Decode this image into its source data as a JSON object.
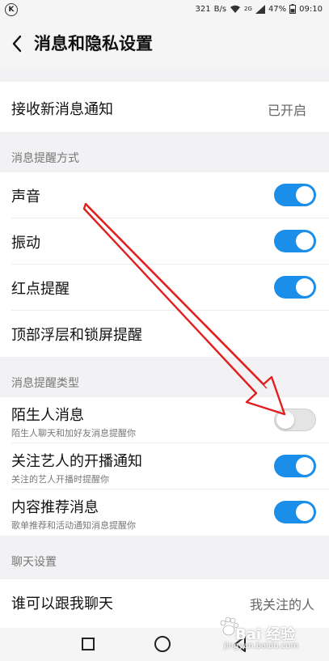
{
  "status_bar": {
    "net_speed": "321",
    "net_unit": "B/s",
    "net_type": "2G",
    "battery": "47%",
    "time": "09:10"
  },
  "header": {
    "title": "消息和隐私设置"
  },
  "rows": {
    "receive": {
      "label": "接收新消息通知",
      "value": "已开启"
    },
    "sound": {
      "label": "声音"
    },
    "vibrate": {
      "label": "振动"
    },
    "reddot": {
      "label": "红点提醒"
    },
    "topfloat": {
      "label": "顶部浮层和锁屏提醒"
    },
    "stranger": {
      "label": "陌生人消息",
      "sub": "陌生人聊天和加好友消息提醒你"
    },
    "artist": {
      "label": "关注艺人的开播通知",
      "sub": "关注的艺人开播时提醒你"
    },
    "recommend": {
      "label": "内容推荐消息",
      "sub": "歌单推荐和活动通知消息提醒你"
    },
    "chat": {
      "label": "谁可以跟我聊天",
      "value": "我关注的人"
    }
  },
  "sections": {
    "method": "消息提醒方式",
    "type": "消息提醒类型",
    "chat": "聊天设置"
  },
  "toggles": {
    "sound": true,
    "vibrate": true,
    "reddot": true,
    "stranger": false,
    "artist": true,
    "recommend": true
  },
  "watermark": {
    "text": "Bai 经验",
    "url": "jingyan.baidu.com"
  },
  "colors": {
    "accent": "#1a8ee8",
    "annotation_arrow": "#e02020"
  }
}
